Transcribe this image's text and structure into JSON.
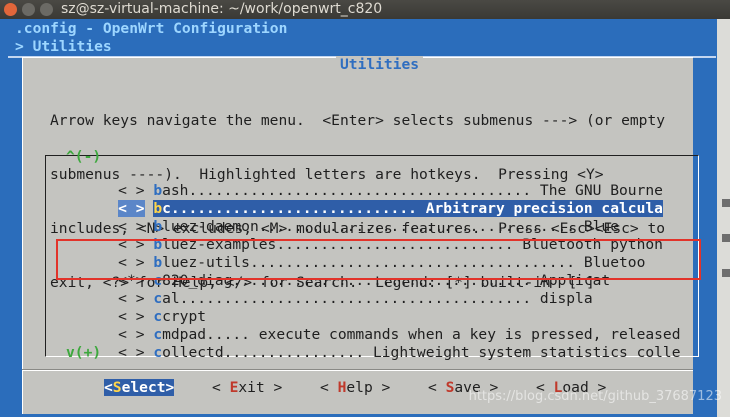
{
  "window": {
    "title": "sz@sz-virtual-machine: ~/work/openwrt_c820"
  },
  "header": {
    "line1": ".config - OpenWrt Configuration",
    "line2": "> Utilities"
  },
  "dialog": {
    "title": "Utilities",
    "help": [
      "Arrow keys navigate the menu.  <Enter> selects submenus ---> (or empty",
      "submenus ----).  Highlighted letters are hotkeys.  Pressing <Y>",
      "includes, <N> excludes, <M> modularizes features.  Press <Esc><Esc> to",
      "exit, <?> for Help, </> for Search.  Legend: [*] built-in  [ ]"
    ],
    "scroll_up": "^(-)",
    "scroll_down": "v(+)",
    "items": [
      {
        "box": "< >",
        "hotkey": "b",
        "rest": "ash....................................... The GNU Bourne",
        "selected": false
      },
      {
        "box": "< >",
        "hotkey": "b",
        "rest": "c............................ Arbitrary precision calcula",
        "selected": true
      },
      {
        "box": "< >",
        "hotkey": "b",
        "rest": "luez-daemon.................................... Blue",
        "selected": false
      },
      {
        "box": "< >",
        "hotkey": "b",
        "rest": "luez-examples........................... Bluetooth python",
        "selected": false
      },
      {
        "box": "< >",
        "hotkey": "b",
        "rest": "luez-utils..................................... Bluetoo",
        "selected": false
      },
      {
        "box": "<*>",
        "hotkey": "c",
        "rest": "820_diag.................................. Applicat",
        "selected": false
      },
      {
        "box": "< >",
        "hotkey": "c",
        "rest": "al........................................ displa",
        "selected": false
      },
      {
        "box": "< >",
        "hotkey": "c",
        "rest": "crypt",
        "selected": false
      },
      {
        "box": "< >",
        "hotkey": "c",
        "rest": "mdpad..... execute commands when a key is pressed, released",
        "selected": false
      },
      {
        "box": "< >",
        "hotkey": "c",
        "rest": "ollectd................ Lightweight system statistics colle",
        "selected": false
      }
    ],
    "buttons": [
      {
        "pre": "<",
        "hotkey": "S",
        "post": "elect>",
        "selected": true
      },
      {
        "pre": "< ",
        "hotkey": "E",
        "post": "xit >",
        "selected": false
      },
      {
        "pre": "< ",
        "hotkey": "H",
        "post": "elp >",
        "selected": false
      },
      {
        "pre": "< ",
        "hotkey": "S",
        "post": "ave >",
        "selected": false
      },
      {
        "pre": "< ",
        "hotkey": "L",
        "post": "oad >",
        "selected": false
      }
    ]
  },
  "watermark": "https://blog.csdn.net/github_37687123",
  "colors": {
    "terminal_bg": "#2b6dbb",
    "dialog_bg": "#c4c4c0",
    "selection": "#2f5ea8",
    "highlight_box": "#e2332a"
  }
}
